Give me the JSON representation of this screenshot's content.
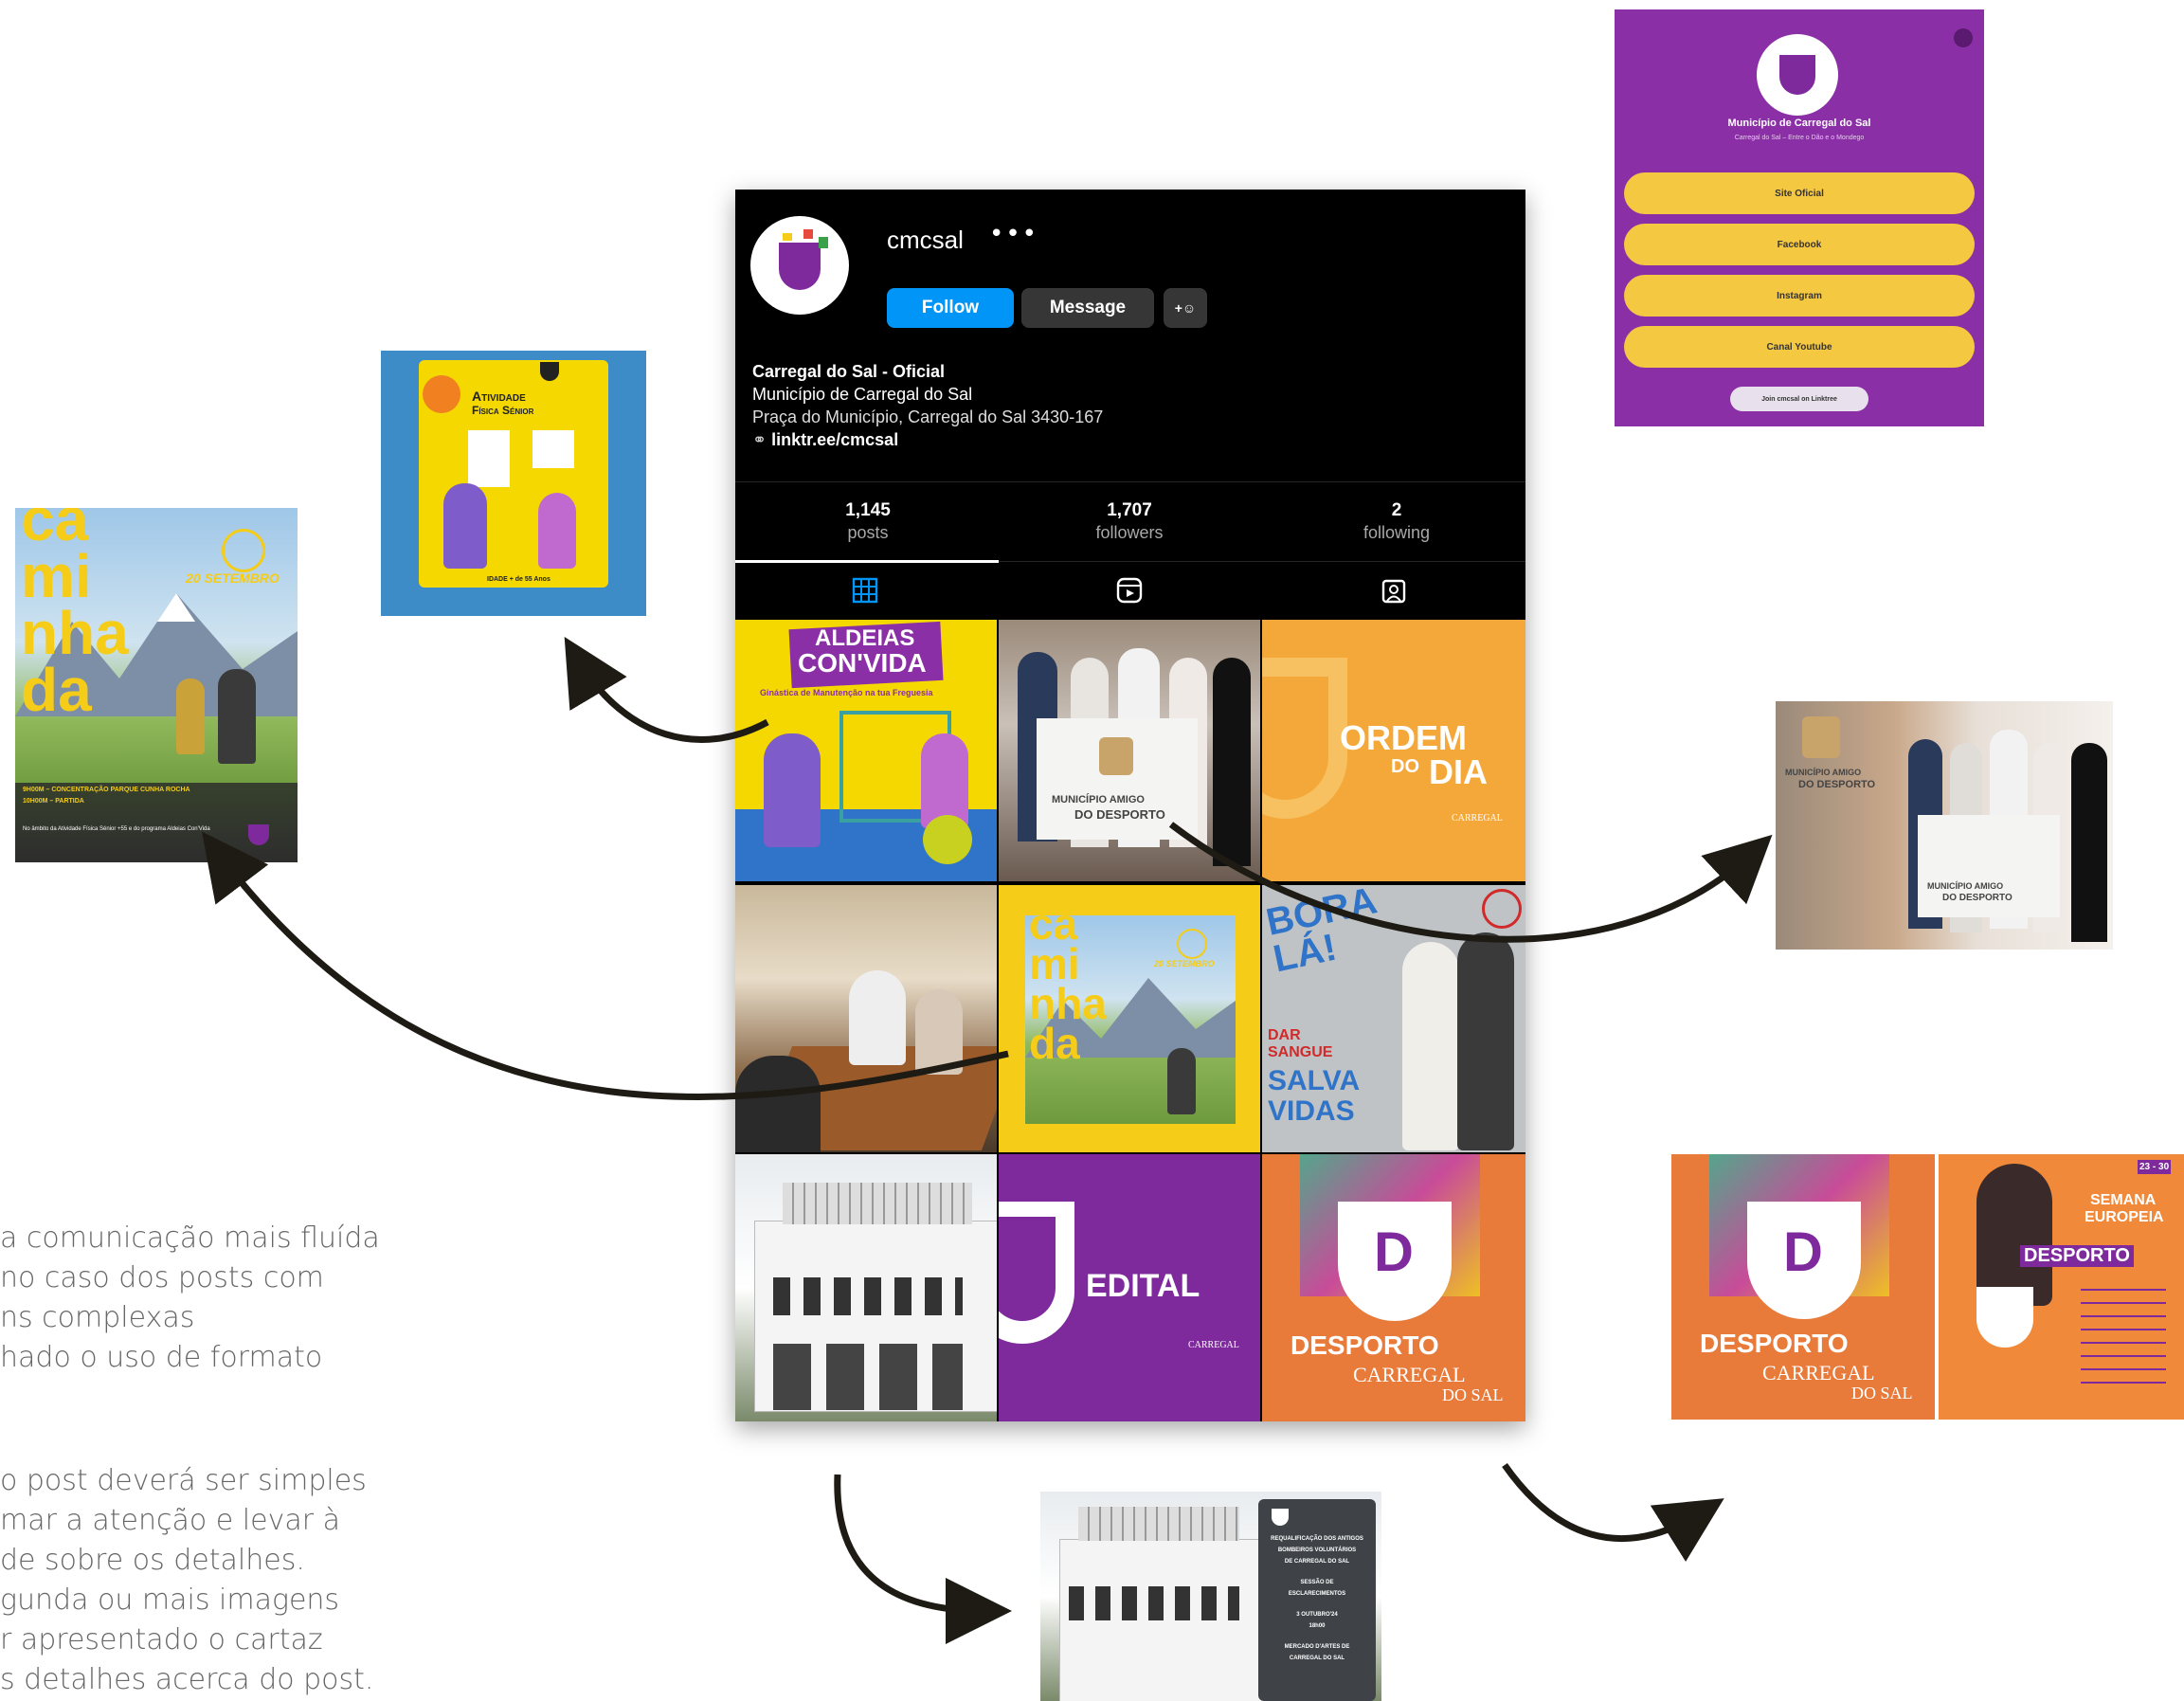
{
  "profile": {
    "username": "cmcsal",
    "more": "•••",
    "follow_label": "Follow",
    "message_label": "Message",
    "add_person": "+☺",
    "name": "Carregal do Sal - Oficial",
    "bio_line1": "Município de Carregal do Sal",
    "bio_line2": "Praça do Município, Carregal do Sal 3430-167",
    "link": "linktr.ee/cmcsal",
    "stats": [
      {
        "value": "1,145",
        "label": "posts"
      },
      {
        "value": "1,707",
        "label": "followers"
      },
      {
        "value": "2",
        "label": "following"
      }
    ]
  },
  "posts": {
    "aldeias_title1": "ALDEIAS",
    "aldeias_title2": "CON'VIDA",
    "aldeias_sub": "Ginástica de Manutenção na tua Freguesia",
    "amigo1": "MUNICÍPIO AMIGO",
    "amigo2": "DO DESPORTO",
    "ordem1": "ORDEM",
    "ordem2": "DO",
    "ordem3": "DIA",
    "brand": "CARREGAL",
    "brand_sub": "DO SAL",
    "cam1": "ca",
    "cam2": "mi",
    "cam3": "nha",
    "cam4": "da",
    "date": "20 SETEMBRO",
    "bora1": "BORA",
    "bora2": "LÁ!",
    "dar1": "DAR",
    "dar2": "SANGUE",
    "dar3": "SALVA",
    "dar4": "VIDAS",
    "edital": "EDITAL",
    "desporto": "DESPORTO",
    "desporto_sub1": "CARREGAL",
    "desporto_sub2": "DO SAL"
  },
  "side": {
    "atividade1": "Atividade",
    "atividade2": "Física Sénior",
    "idade": "IDADE + de 55 Anos",
    "caminhada_line1": "9H00M – CONCENTRAÇÃO PARQUE CUNHA ROCHA",
    "caminhada_line2": "10H00M – PARTIDA",
    "caminhada_note": "No âmbito da Atividade Física Sénior +55 e do programa Aldeias Con'Vida",
    "semana1": "SEMANA",
    "semana2": "EUROPEIA",
    "semana_desporto": "DESPORTO",
    "semana_dates": "23 - 30",
    "esclarecimentos": [
      "REQUALIFICAÇÃO DOS ANTIGOS",
      "BOMBEIROS VOLUNTÁRIOS",
      "DE CARREGAL DO SAL",
      "SESSÃO DE",
      "ESCLARECIMENTOS",
      "3 OUTUBRO'24",
      "18h00",
      "MERCADO D'ARTES DE",
      "CARREGAL DO SAL"
    ]
  },
  "linktree": {
    "title": "Município de Carregal do Sal",
    "subtitle": "Carregal do Sal – Entre o Dão e o Mondego",
    "links": [
      "Site Oficial",
      "Facebook",
      "Instagram",
      "Canal Youtube"
    ],
    "join": "Join cmcsal on Linktree"
  },
  "text_blocks": {
    "block1": [
      "a comunicação mais fluída",
      "no caso dos posts com",
      "ns complexas",
      "hado o uso de formato"
    ],
    "block2": [
      "o post deverá ser simples",
      "mar a atenção e levar à",
      "de sobre os detalhes.",
      "gunda ou mais imagens",
      "r apresentado o cartaz",
      "s detalhes acerca do post."
    ]
  },
  "colors": {
    "purple": "#7e2a9c",
    "yellow": "#f5cc18",
    "ig_blue": "#0095f6",
    "orange": "#f0a030"
  }
}
